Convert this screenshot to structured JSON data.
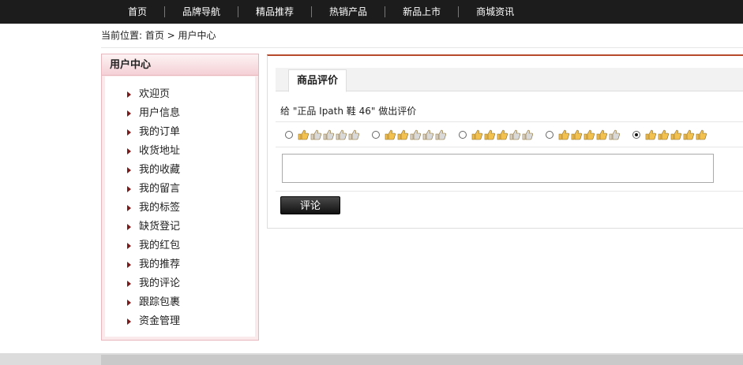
{
  "nav": {
    "items": [
      "首页",
      "品牌导航",
      "精品推荐",
      "热销产品",
      "新品上市",
      "商城资讯"
    ]
  },
  "breadcrumb": "当前位置: 首页 > 用户中心",
  "sidebar": {
    "title": "用户中心",
    "items": [
      "欢迎页",
      "用户信息",
      "我的订单",
      "收货地址",
      "我的收藏",
      "我的留言",
      "我的标签",
      "缺货登记",
      "我的红包",
      "我的推荐",
      "我的评论",
      "跟踪包裹",
      "资金管理"
    ]
  },
  "review": {
    "tab_label": "商品评价",
    "prompt": "给 \"正品 Ipath 鞋 46\" 做出评价",
    "ratings": [
      1,
      2,
      3,
      4,
      5
    ],
    "max_rating": 5,
    "selected_rating": 5,
    "comment_value": "",
    "submit_label": "评论"
  },
  "colors": {
    "nav_bg": "#1c1c1c",
    "accent": "#b64a2a",
    "sidebar_border": "#e8b6bd",
    "thumb_on": "#f2c14e",
    "thumb_off": "#d9d9d9"
  },
  "icons": {
    "sidebar_bullet": "triangle-right-icon",
    "rating": "thumbs-up-icon"
  }
}
